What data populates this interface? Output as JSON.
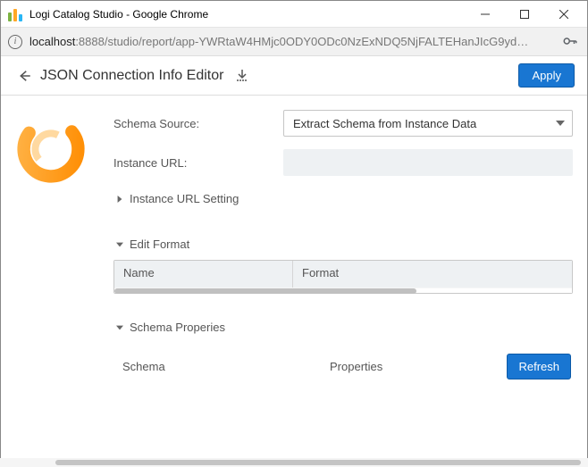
{
  "window": {
    "title": "Logi Catalog Studio - Google Chrome"
  },
  "urlbar": {
    "host": "localhost",
    "path": ":8888/studio/report/app-YWRtaW4HMjc0ODY0ODc0NzExNDQ5NjFALTEHanJIcG9yd…"
  },
  "header": {
    "title": "JSON Connection Info Editor",
    "apply_label": "Apply"
  },
  "form": {
    "schema_source_label": "Schema Source:",
    "schema_source_value": "Extract Schema from Instance Data",
    "instance_url_label": "Instance URL:",
    "instance_url_value": ""
  },
  "sections": {
    "instance_url_setting": "Instance URL Setting",
    "edit_format": "Edit Format",
    "schema_properties": "Schema Properies"
  },
  "edit_format_table": {
    "columns": [
      "Name",
      "Format"
    ]
  },
  "schema_panel": {
    "schema_col": "Schema",
    "properties_col": "Properties",
    "refresh_label": "Refresh"
  }
}
